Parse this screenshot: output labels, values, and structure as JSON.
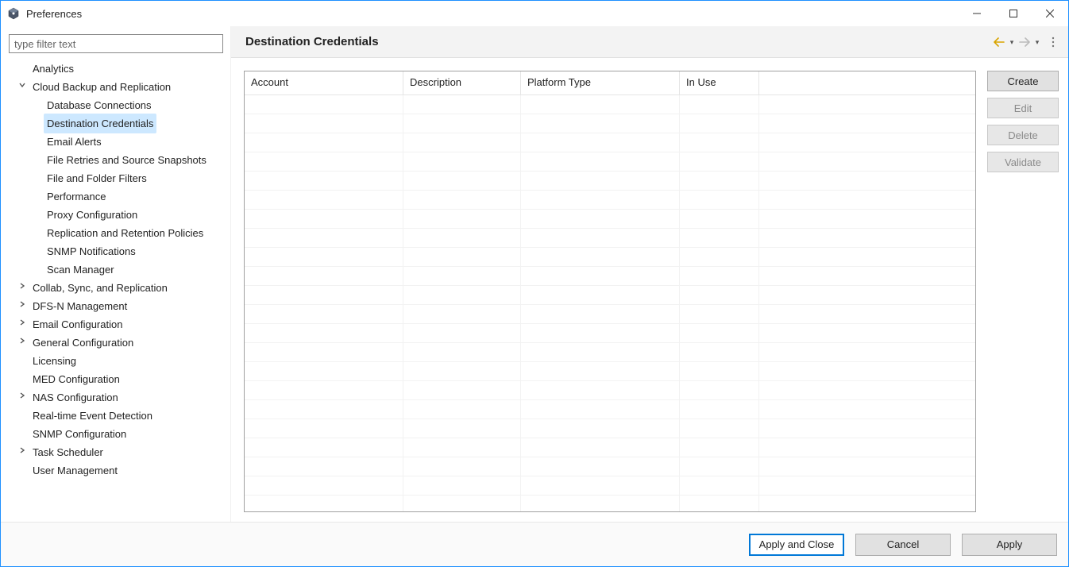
{
  "window": {
    "title": "Preferences"
  },
  "filter": {
    "placeholder": "type filter text"
  },
  "tree": [
    {
      "label": "Analytics",
      "depth": 0,
      "twisty": ""
    },
    {
      "label": "Cloud Backup and Replication",
      "depth": 0,
      "twisty": "open"
    },
    {
      "label": "Database Connections",
      "depth": 1,
      "twisty": ""
    },
    {
      "label": "Destination Credentials",
      "depth": 1,
      "twisty": "",
      "selected": true
    },
    {
      "label": "Email Alerts",
      "depth": 1,
      "twisty": ""
    },
    {
      "label": "File Retries and Source Snapshots",
      "depth": 1,
      "twisty": ""
    },
    {
      "label": "File and Folder Filters",
      "depth": 1,
      "twisty": ""
    },
    {
      "label": "Performance",
      "depth": 1,
      "twisty": ""
    },
    {
      "label": "Proxy Configuration",
      "depth": 1,
      "twisty": ""
    },
    {
      "label": "Replication and Retention Policies",
      "depth": 1,
      "twisty": ""
    },
    {
      "label": "SNMP Notifications",
      "depth": 1,
      "twisty": ""
    },
    {
      "label": "Scan Manager",
      "depth": 1,
      "twisty": ""
    },
    {
      "label": "Collab, Sync, and Replication",
      "depth": 0,
      "twisty": "closed"
    },
    {
      "label": "DFS-N Management",
      "depth": 0,
      "twisty": "closed"
    },
    {
      "label": "Email Configuration",
      "depth": 0,
      "twisty": "closed"
    },
    {
      "label": "General Configuration",
      "depth": 0,
      "twisty": "closed"
    },
    {
      "label": "Licensing",
      "depth": 0,
      "twisty": ""
    },
    {
      "label": "MED Configuration",
      "depth": 0,
      "twisty": ""
    },
    {
      "label": "NAS Configuration",
      "depth": 0,
      "twisty": "closed"
    },
    {
      "label": "Real-time Event Detection",
      "depth": 0,
      "twisty": ""
    },
    {
      "label": "SNMP Configuration",
      "depth": 0,
      "twisty": ""
    },
    {
      "label": "Task Scheduler",
      "depth": 0,
      "twisty": "closed"
    },
    {
      "label": "User Management",
      "depth": 0,
      "twisty": ""
    }
  ],
  "page": {
    "title": "Destination Credentials"
  },
  "table": {
    "columns": [
      "Account",
      "Description",
      "Platform Type",
      "In Use"
    ],
    "rows": []
  },
  "actions": {
    "create": "Create",
    "edit": "Edit",
    "delete": "Delete",
    "validate": "Validate"
  },
  "footer": {
    "apply_close": "Apply and Close",
    "cancel": "Cancel",
    "apply": "Apply"
  }
}
